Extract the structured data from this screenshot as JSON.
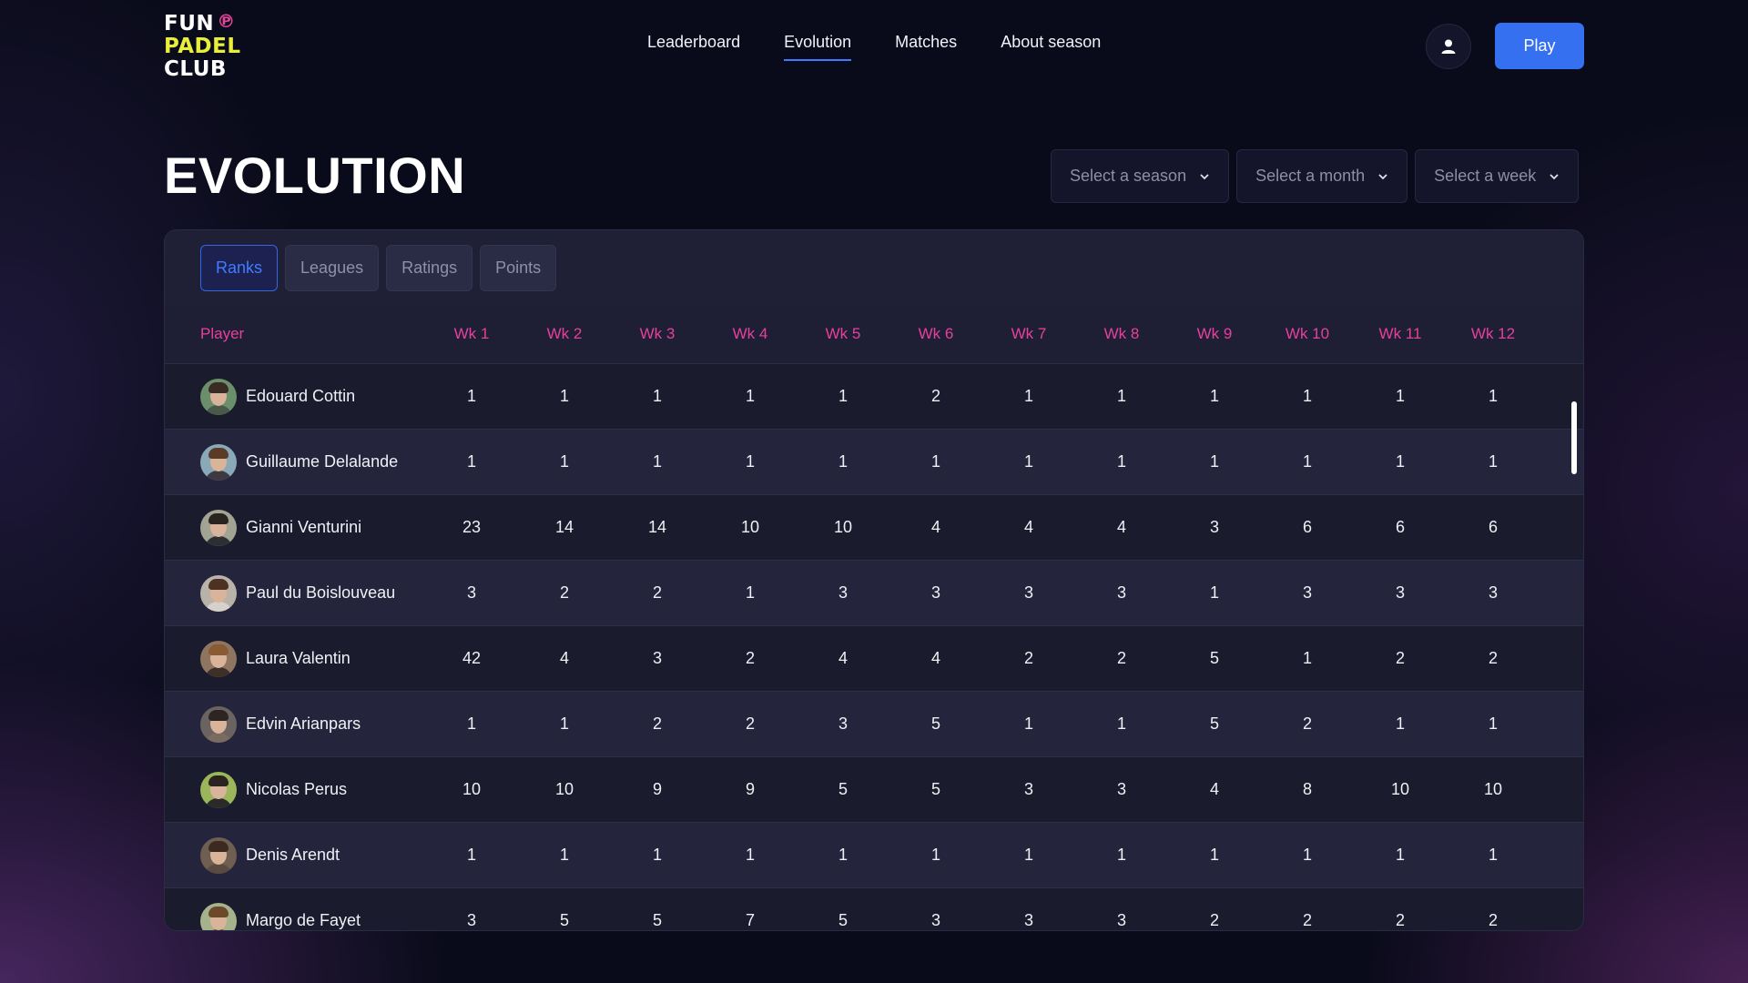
{
  "logo": {
    "line1": "FUN",
    "line2": "PADEL",
    "line3": "CLUB"
  },
  "nav": {
    "items": [
      {
        "label": "Leaderboard",
        "active": false
      },
      {
        "label": "Evolution",
        "active": true
      },
      {
        "label": "Matches",
        "active": false
      },
      {
        "label": "About season",
        "active": false
      }
    ]
  },
  "header": {
    "play_label": "Play"
  },
  "page": {
    "title": "EVOLUTION"
  },
  "filters": {
    "season": "Select a season",
    "month": "Select a month",
    "week": "Select a week"
  },
  "tabs": [
    {
      "label": "Ranks",
      "active": true
    },
    {
      "label": "Leagues",
      "active": false
    },
    {
      "label": "Ratings",
      "active": false
    },
    {
      "label": "Points",
      "active": false
    }
  ],
  "table": {
    "player_header": "Player",
    "week_headers": [
      "Wk 1",
      "Wk 2",
      "Wk 3",
      "Wk 4",
      "Wk 5",
      "Wk 6",
      "Wk 7",
      "Wk 8",
      "Wk 9",
      "Wk 10",
      "Wk 11",
      "Wk 12"
    ],
    "rows": [
      {
        "name": "Edouard Cottin",
        "ranks": [
          1,
          1,
          1,
          1,
          1,
          2,
          1,
          1,
          1,
          1,
          1,
          1
        ]
      },
      {
        "name": "Guillaume Delalande",
        "ranks": [
          1,
          1,
          1,
          1,
          1,
          1,
          1,
          1,
          1,
          1,
          1,
          1
        ]
      },
      {
        "name": "Gianni Venturini",
        "ranks": [
          23,
          14,
          14,
          10,
          10,
          4,
          4,
          4,
          3,
          6,
          6,
          6
        ]
      },
      {
        "name": "Paul du Boislouveau",
        "ranks": [
          3,
          2,
          2,
          1,
          3,
          3,
          3,
          3,
          1,
          3,
          3,
          3
        ]
      },
      {
        "name": "Laura Valentin",
        "ranks": [
          42,
          4,
          3,
          2,
          4,
          4,
          2,
          2,
          5,
          1,
          2,
          2
        ]
      },
      {
        "name": "Edvin Arianpars",
        "ranks": [
          1,
          1,
          2,
          2,
          3,
          5,
          1,
          1,
          5,
          2,
          1,
          1
        ]
      },
      {
        "name": "Nicolas Perus",
        "ranks": [
          10,
          10,
          9,
          9,
          5,
          5,
          3,
          3,
          4,
          8,
          10,
          10
        ]
      },
      {
        "name": "Denis Arendt",
        "ranks": [
          1,
          1,
          1,
          1,
          1,
          1,
          1,
          1,
          1,
          1,
          1,
          1
        ]
      },
      {
        "name": "Margo de Fayet",
        "ranks": [
          3,
          5,
          5,
          7,
          5,
          3,
          3,
          3,
          2,
          2,
          2,
          2
        ]
      }
    ]
  },
  "colors": {
    "accent": "#3470f0",
    "header_pink": "#e6409d",
    "logo_yellow": "#e8ee3a"
  }
}
